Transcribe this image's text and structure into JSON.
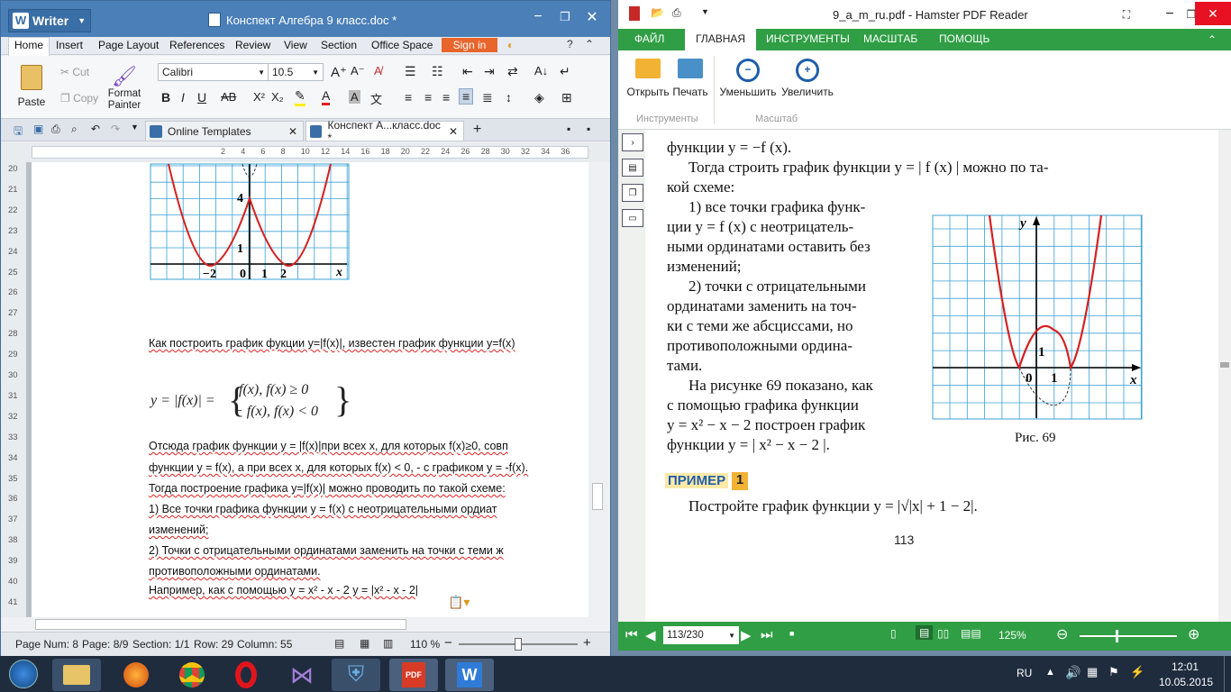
{
  "wps": {
    "app_name": "Writer",
    "window_title": "Конспект Алгебра 9 класс.doc *",
    "tabs": [
      "Home",
      "Insert",
      "Page Layout",
      "References",
      "Review",
      "View",
      "Section",
      "Office Space"
    ],
    "sign_in": "Sign in",
    "clipboard": {
      "paste": "Paste",
      "cut": "Cut",
      "copy": "Copy",
      "format_painter": "Format Painter"
    },
    "font_name": "Calibri",
    "font_size": "10.5",
    "doc_tabs": [
      "Online Templates",
      "Конспект А...класс.doc *"
    ],
    "ruler_marks": [
      "2",
      "4",
      "6",
      "8",
      "10",
      "12",
      "14",
      "16",
      "18",
      "20",
      "22",
      "24",
      "26",
      "28",
      "30",
      "32",
      "34",
      "36"
    ],
    "line_numbers": [
      "20",
      "21",
      "22",
      "23",
      "24",
      "25",
      "26",
      "27",
      "28",
      "29",
      "30",
      "31",
      "32",
      "33",
      "34",
      "35",
      "36",
      "37",
      "38",
      "39",
      "40",
      "41"
    ],
    "graph_labels": {
      "y4": "4",
      "y1": "1",
      "xm2": "−2",
      "x0": "0",
      "x1": "1",
      "x2": "2",
      "x": "x"
    },
    "body": {
      "heading": "Как построить график фукции y=|f(x)|, известен график функции y=f(x)",
      "formula_left": "y = |f(x)| =",
      "formula_case1": "f(x), f(x) ≥ 0",
      "formula_case2": "− f(x), f(x) < 0",
      "p1": "Отсюда  график  функции  y  =  |f(x)|при  всех  x,  для  которых  f(x)≥0,  совп",
      "p2": "функции y = f(x), а при всех x, для которых f(x) < 0, - с графиком y = -f(x).",
      "p3": "Тогда построение графика y=|f(x)| можно проводить по такой схеме:",
      "p4": "1)     Все  точки  графика  функции  y  =  f(x)  с  неотрицательными  ордиат",
      "p5": "изменений;",
      "p6": "2)     Точки  с  отрицательными  ординатами  заменить  на  точки  с  теми  ж",
      "p7": "противоположными ординатами.",
      "p8": "Например, как с помощью y = x² - x - 2 y = |x² - x - 2|"
    },
    "status": {
      "page_num": "Page Num: 8",
      "page": "Page: 8/9",
      "section": "Section: 1/1",
      "row": "Row: 29",
      "column": "Column: 55",
      "zoom": "110 %"
    }
  },
  "pdf": {
    "title": "9_a_m_ru.pdf - Hamster PDF Reader",
    "tabs": [
      "ФАЙЛ",
      "ГЛАВНАЯ",
      "ИНСТРУМЕНТЫ",
      "МАСШТАБ",
      "ПОМОЩЬ"
    ],
    "buttons": {
      "open": "Открыть",
      "print": "Печать",
      "zoom_out": "Уменьшить",
      "zoom_in": "Увеличить"
    },
    "groups": {
      "tools": "Инструменты",
      "scale": "Масштаб"
    },
    "text": {
      "l0": "функции  y = −f (x).",
      "l1": "Тогда строить график функции  y = | f (x) | можно по та-",
      "l2": "кой схеме:",
      "l3": "1) все точки графика функ-",
      "l4": "ции  y = f (x)  с неотрицатель-",
      "l5": "ными ординатами оставить без",
      "l6": "изменений;",
      "l7": "2) точки с отрицательными",
      "l8": "ординатами заменить на точ-",
      "l9": "ки с теми же абсциссами, но",
      "l10": "противоположными ордина-",
      "l11": "тами.",
      "l12": "На рисунке 69 показано, как",
      "l13": "с помощью графика функции",
      "l14": "y = x² − x − 2 построен график",
      "l15": "функции  y = | x² − x − 2 |.",
      "fig": "Рис. 69",
      "example_label": "ПРИМЕР",
      "example_num": "1",
      "task": "Постройте график функции  y = |√|x| + 1 − 2|.",
      "page_number": "113"
    },
    "graph_labels": {
      "y": "y",
      "x": "x",
      "o": "0",
      "one_x": "1",
      "one_y": "1"
    },
    "page_field": "113/230",
    "zoom": "125%"
  },
  "taskbar": {
    "lang": "RU",
    "time": "12:01",
    "date": "10.05.2015"
  }
}
